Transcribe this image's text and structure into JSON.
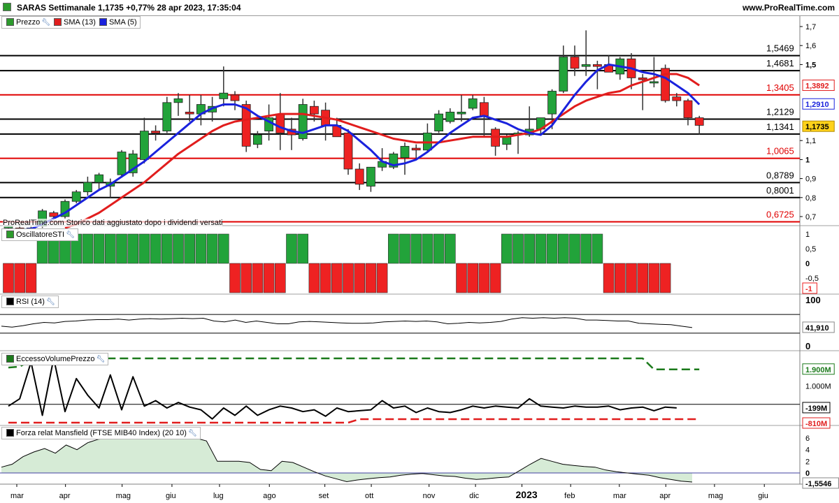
{
  "header": {
    "title": "SARAS Settimanale 1,1735 +0,77% 28 apr 2023, 17:35:04",
    "site": "www.ProRealTime.com"
  },
  "legends": {
    "price": {
      "prezzo": "Prezzo",
      "sma13": "SMA (13)",
      "sma5": "SMA (5)"
    },
    "sti": "OscillatoreSTI",
    "rsi": "RSI (14)",
    "evp": "EccessoVolumePrezzo",
    "mansfield": "Forza relat Mansfield (FTSE MIB40 Index) (20 10)"
  },
  "note": "ProRealTime.com  Storico dati aggiustato dopo i dividendi versati",
  "colors": {
    "up": "#22a33a",
    "down": "#ee2222",
    "sma5": "#1a22dd",
    "sma13": "#e11d1d",
    "level_black": "#000000",
    "level_red": "#e00000",
    "rsi": "#000000",
    "mansfield_fill_pos": "#cfe8cf",
    "mansfield_fill_neg": "#e8c7c7"
  },
  "chart_data": [
    {
      "type": "candlestick",
      "name": "price",
      "ylim": [
        0.64,
        1.74
      ],
      "y_ticks": [
        "0,7",
        "0,8",
        "0,9",
        "1",
        "1,1",
        "1,5",
        "1,6",
        "1,7"
      ],
      "x_ticks": [
        "mar",
        "apr",
        "mag",
        "giu",
        "lug",
        "ago",
        "set",
        "ott",
        "nov",
        "dic",
        "2023",
        "feb",
        "mar",
        "apr",
        "mag",
        "giu"
      ],
      "x_tick_weeks": [
        0,
        4.3,
        9.3,
        13.7,
        17.9,
        22.3,
        27.2,
        31.3,
        36.4,
        40.5,
        44.6,
        48.9,
        53.2,
        57.3,
        61.6,
        66
      ],
      "levels": [
        {
          "value": 1.5469,
          "label": "1,5469",
          "color": "black"
        },
        {
          "value": 1.4681,
          "label": "1,4681",
          "color": "black"
        },
        {
          "value": 1.3405,
          "label": "1,3405",
          "color": "red"
        },
        {
          "value": 1.2129,
          "label": "1,2129",
          "color": "black"
        },
        {
          "value": 1.1341,
          "label": "1,1341",
          "color": "black"
        },
        {
          "value": 1.0065,
          "label": "1,0065",
          "color": "red"
        },
        {
          "value": 0.8789,
          "label": "0,8789",
          "color": "black"
        },
        {
          "value": 0.8001,
          "label": "0,8001",
          "color": "black"
        },
        {
          "value": 0.6725,
          "label": "0,6725",
          "color": "red"
        }
      ],
      "last_price": {
        "value": 1.1735,
        "label": "1,1735"
      },
      "sma13_last": {
        "value": 1.3892,
        "label": "1,3892"
      },
      "sma5_last": {
        "value": 1.291,
        "label": "1,2910"
      },
      "candles": [
        {
          "o": 0.64,
          "h": 0.66,
          "l": 0.6,
          "c": 0.65
        },
        {
          "o": 0.64,
          "h": 0.66,
          "l": 0.61,
          "c": 0.63
        },
        {
          "o": 0.63,
          "h": 0.65,
          "l": 0.6,
          "c": 0.64
        },
        {
          "o": 0.65,
          "h": 0.74,
          "l": 0.64,
          "c": 0.73
        },
        {
          "o": 0.72,
          "h": 0.73,
          "l": 0.68,
          "c": 0.7
        },
        {
          "o": 0.7,
          "h": 0.79,
          "l": 0.69,
          "c": 0.78
        },
        {
          "o": 0.78,
          "h": 0.84,
          "l": 0.77,
          "c": 0.83
        },
        {
          "o": 0.83,
          "h": 0.91,
          "l": 0.81,
          "c": 0.88
        },
        {
          "o": 0.88,
          "h": 0.93,
          "l": 0.84,
          "c": 0.92
        },
        {
          "o": 0.86,
          "h": 0.9,
          "l": 0.8,
          "c": 0.88
        },
        {
          "o": 0.92,
          "h": 1.05,
          "l": 0.91,
          "c": 1.04
        },
        {
          "o": 0.93,
          "h": 1.05,
          "l": 0.91,
          "c": 1.03
        },
        {
          "o": 1.0,
          "h": 1.22,
          "l": 0.98,
          "c": 1.15
        },
        {
          "o": 1.15,
          "h": 1.18,
          "l": 1.1,
          "c": 1.14
        },
        {
          "o": 1.15,
          "h": 1.33,
          "l": 1.14,
          "c": 1.3
        },
        {
          "o": 1.3,
          "h": 1.35,
          "l": 1.23,
          "c": 1.32
        },
        {
          "o": 1.25,
          "h": 1.34,
          "l": 1.2,
          "c": 1.24
        },
        {
          "o": 1.24,
          "h": 1.34,
          "l": 1.18,
          "c": 1.29
        },
        {
          "o": 1.25,
          "h": 1.33,
          "l": 1.2,
          "c": 1.28
        },
        {
          "o": 1.32,
          "h": 1.49,
          "l": 1.28,
          "c": 1.35
        },
        {
          "o": 1.34,
          "h": 1.36,
          "l": 1.26,
          "c": 1.31
        },
        {
          "o": 1.29,
          "h": 1.31,
          "l": 1.04,
          "c": 1.07
        },
        {
          "o": 1.08,
          "h": 1.15,
          "l": 1.06,
          "c": 1.13
        },
        {
          "o": 1.15,
          "h": 1.29,
          "l": 1.1,
          "c": 1.22
        },
        {
          "o": 1.24,
          "h": 1.35,
          "l": 1.05,
          "c": 1.14
        },
        {
          "o": 1.16,
          "h": 1.22,
          "l": 1.05,
          "c": 1.13
        },
        {
          "o": 1.11,
          "h": 1.32,
          "l": 1.1,
          "c": 1.29
        },
        {
          "o": 1.28,
          "h": 1.31,
          "l": 1.2,
          "c": 1.24
        },
        {
          "o": 1.26,
          "h": 1.3,
          "l": 1.1,
          "c": 1.18
        },
        {
          "o": 1.18,
          "h": 1.22,
          "l": 1.12,
          "c": 1.12
        },
        {
          "o": 1.14,
          "h": 1.16,
          "l": 0.92,
          "c": 0.95
        },
        {
          "o": 0.95,
          "h": 0.98,
          "l": 0.84,
          "c": 0.87
        },
        {
          "o": 0.86,
          "h": 0.96,
          "l": 0.83,
          "c": 0.96
        },
        {
          "o": 0.96,
          "h": 1.06,
          "l": 0.94,
          "c": 0.99
        },
        {
          "o": 0.96,
          "h": 1.04,
          "l": 0.95,
          "c": 1.03
        },
        {
          "o": 1.01,
          "h": 1.09,
          "l": 0.92,
          "c": 1.07
        },
        {
          "o": 1.06,
          "h": 1.08,
          "l": 1.0,
          "c": 1.05
        },
        {
          "o": 1.05,
          "h": 1.19,
          "l": 1.04,
          "c": 1.14
        },
        {
          "o": 1.15,
          "h": 1.26,
          "l": 1.14,
          "c": 1.24
        },
        {
          "o": 1.2,
          "h": 1.27,
          "l": 1.19,
          "c": 1.25
        },
        {
          "o": 1.24,
          "h": 1.34,
          "l": 1.2,
          "c": 1.25
        },
        {
          "o": 1.27,
          "h": 1.34,
          "l": 1.26,
          "c": 1.32
        },
        {
          "o": 1.3,
          "h": 1.33,
          "l": 1.12,
          "c": 1.23
        },
        {
          "o": 1.16,
          "h": 1.17,
          "l": 1.02,
          "c": 1.07
        },
        {
          "o": 1.08,
          "h": 1.13,
          "l": 1.05,
          "c": 1.12
        },
        {
          "o": 1.13,
          "h": 1.15,
          "l": 1.03,
          "c": 1.14
        },
        {
          "o": 1.13,
          "h": 1.28,
          "l": 1.12,
          "c": 1.16
        },
        {
          "o": 1.16,
          "h": 1.22,
          "l": 1.13,
          "c": 1.22
        },
        {
          "o": 1.24,
          "h": 1.37,
          "l": 1.16,
          "c": 1.36
        },
        {
          "o": 1.36,
          "h": 1.6,
          "l": 1.35,
          "c": 1.54
        },
        {
          "o": 1.54,
          "h": 1.6,
          "l": 1.44,
          "c": 1.48
        },
        {
          "o": 1.49,
          "h": 1.68,
          "l": 1.44,
          "c": 1.5
        },
        {
          "o": 1.5,
          "h": 1.52,
          "l": 1.37,
          "c": 1.49
        },
        {
          "o": 1.5,
          "h": 1.55,
          "l": 1.47,
          "c": 1.46
        },
        {
          "o": 1.45,
          "h": 1.54,
          "l": 1.42,
          "c": 1.53
        },
        {
          "o": 1.53,
          "h": 1.56,
          "l": 1.37,
          "c": 1.43
        },
        {
          "o": 1.43,
          "h": 1.45,
          "l": 1.26,
          "c": 1.42
        },
        {
          "o": 1.41,
          "h": 1.54,
          "l": 1.38,
          "c": 1.41
        },
        {
          "o": 1.48,
          "h": 1.5,
          "l": 1.3,
          "c": 1.31
        },
        {
          "o": 1.33,
          "h": 1.35,
          "l": 1.28,
          "c": 1.31
        },
        {
          "o": 1.31,
          "h": 1.32,
          "l": 1.18,
          "c": 1.22
        },
        {
          "o": 1.22,
          "h": 1.23,
          "l": 1.13,
          "c": 1.18
        }
      ],
      "sma5": [
        0.62,
        0.63,
        0.635,
        0.66,
        0.69,
        0.72,
        0.76,
        0.8,
        0.84,
        0.87,
        0.91,
        0.95,
        0.99,
        1.04,
        1.09,
        1.14,
        1.19,
        1.24,
        1.27,
        1.29,
        1.29,
        1.27,
        1.23,
        1.2,
        1.17,
        1.15,
        1.14,
        1.16,
        1.18,
        1.18,
        1.15,
        1.1,
        1.05,
        0.99,
        0.97,
        0.98,
        1.0,
        1.04,
        1.09,
        1.14,
        1.18,
        1.22,
        1.23,
        1.21,
        1.19,
        1.16,
        1.14,
        1.13,
        1.18,
        1.26,
        1.34,
        1.41,
        1.47,
        1.5,
        1.49,
        1.48,
        1.46,
        1.45,
        1.43,
        1.39,
        1.35,
        1.29
      ],
      "sma13": [
        null,
        null,
        null,
        null,
        null,
        0.64,
        0.66,
        0.69,
        0.72,
        0.76,
        0.8,
        0.84,
        0.88,
        0.93,
        0.98,
        1.03,
        1.07,
        1.11,
        1.15,
        1.18,
        1.2,
        1.21,
        1.22,
        1.23,
        1.24,
        1.24,
        1.24,
        1.23,
        1.22,
        1.21,
        1.19,
        1.17,
        1.15,
        1.13,
        1.11,
        1.1,
        1.09,
        1.09,
        1.09,
        1.1,
        1.11,
        1.12,
        1.12,
        1.12,
        1.12,
        1.13,
        1.14,
        1.16,
        1.2,
        1.24,
        1.28,
        1.31,
        1.33,
        1.35,
        1.36,
        1.39,
        1.41,
        1.43,
        1.45,
        1.45,
        1.43,
        1.39
      ]
    },
    {
      "type": "bar",
      "name": "OscillatoreSTI",
      "ylim": [
        -1,
        1
      ],
      "y_ticks": [
        "1",
        "0,5",
        "0",
        "-0,5"
      ],
      "last": {
        "value": -1,
        "label": "-1"
      },
      "values": [
        -1,
        -1,
        -1,
        1,
        1,
        1,
        1,
        1,
        1,
        1,
        1,
        1,
        1,
        1,
        1,
        1,
        1,
        1,
        1,
        1,
        -1,
        -1,
        -1,
        -1,
        -1,
        1,
        1,
        -1,
        -1,
        -1,
        -1,
        -1,
        -1,
        -1,
        1,
        1,
        1,
        1,
        1,
        1,
        -1,
        -1,
        -1,
        -1,
        1,
        1,
        1,
        1,
        1,
        1,
        1,
        1,
        1,
        -1,
        -1,
        -1,
        -1,
        -1,
        -1
      ]
    },
    {
      "type": "line",
      "name": "RSI (14)",
      "ylim": [
        0,
        100
      ],
      "y_ticks": [
        "100",
        "0"
      ],
      "last": {
        "value": 41.91,
        "label": "41,910"
      },
      "values": [
        45,
        43,
        46,
        50,
        53,
        52,
        55,
        56,
        58,
        59,
        59,
        60,
        58,
        60,
        61,
        60,
        61,
        62,
        61,
        62,
        56,
        54,
        58,
        53,
        56,
        53,
        50,
        50,
        54,
        55,
        54,
        53,
        52,
        51,
        51,
        52,
        54,
        55,
        56,
        55,
        56,
        54,
        50,
        51,
        53,
        52,
        53,
        55,
        60,
        63,
        62,
        63,
        62,
        63,
        62,
        58,
        58,
        57,
        56,
        56,
        51,
        50,
        49,
        48,
        45,
        41.91
      ]
    },
    {
      "type": "line",
      "name": "EccessoVolumePrezzo",
      "ylim": [
        -1000000,
        3200000
      ],
      "y_ticks": [
        "1.000M"
      ],
      "series": [
        {
          "name": "upper",
          "last_label": "1.900M",
          "values": [
            2000000,
            2050000,
            2400000,
            2400000,
            2400000,
            2500000,
            2500000,
            2500000,
            2500000,
            2500000,
            2500000,
            2500000,
            2500000,
            2500000,
            2500000,
            2500000,
            2500000,
            2500000,
            2500000,
            2500000,
            2500000,
            2500000,
            2500000,
            2500000,
            2500000,
            2500000,
            2500000,
            2500000,
            2500000,
            2500000,
            2500000,
            2500000,
            2500000,
            2500000,
            2500000,
            2500000,
            2500000,
            2500000,
            2500000,
            2500000,
            2500000,
            2500000,
            2500000,
            2500000,
            2500000,
            2500000,
            2500000,
            2500000,
            2500000,
            2500000,
            2500000,
            2500000,
            2500000,
            2500000,
            2500000,
            2500000,
            2500000,
            1900000,
            1900000,
            1900000,
            1900000,
            1900000
          ]
        },
        {
          "name": "value",
          "last_label": "-199M",
          "values": [
            -100000,
            300000,
            2300000,
            -600000,
            2500000,
            -400000,
            1400000,
            500000,
            -200000,
            1600000,
            -300000,
            1500000,
            -100000,
            200000,
            -200000,
            100000,
            -150000,
            -300000,
            -800000,
            -200000,
            -600000,
            -100000,
            -600000,
            -300000,
            -100000,
            -200000,
            -400000,
            -300000,
            -650000,
            -200000,
            -400000,
            -350000,
            -300000,
            200000,
            -200000,
            -100000,
            -450000,
            -200000,
            -400000,
            -450000,
            -300000,
            -100000,
            -200000,
            -100000,
            -150000,
            -200000,
            300000,
            -100000,
            -150000,
            -200000,
            -100000,
            -150000,
            -150000,
            -100000,
            -300000,
            -200000,
            -150000,
            -350000,
            -150000,
            -199000
          ]
        },
        {
          "name": "lower",
          "last_label": "-810M",
          "values": [
            -1000000,
            -1000000,
            -1000000,
            -1000000,
            -1000000,
            -1000000,
            -1000000,
            -1000000,
            -1000000,
            -1000000,
            -1000000,
            -1000000,
            -1000000,
            -1000000,
            -1000000,
            -1000000,
            -1000000,
            -1000000,
            -1000000,
            -1000000,
            -1000000,
            -1000000,
            -1000000,
            -1000000,
            -1000000,
            -1000000,
            -1000000,
            -1000000,
            -1000000,
            -1000000,
            -1000000,
            -810000,
            -810000,
            -810000,
            -810000,
            -810000,
            -810000,
            -810000,
            -810000,
            -810000,
            -810000,
            -810000,
            -810000,
            -810000,
            -810000,
            -810000,
            -810000,
            -810000,
            -810000,
            -810000,
            -810000,
            -810000,
            -810000,
            -810000,
            -810000,
            -810000,
            -810000,
            -810000,
            -810000,
            -810000,
            -810000,
            -810000
          ]
        }
      ]
    },
    {
      "type": "area",
      "name": "Forza relat Mansfield (FTSE MIB40 Index) (20 10)",
      "ylim": [
        -3,
        7
      ],
      "y_ticks": [
        "6",
        "4",
        "2",
        "0"
      ],
      "last": {
        "value": -1.5546,
        "label": "-1,5546"
      },
      "values": [
        1,
        1.5,
        2.8,
        3.6,
        4.2,
        3.4,
        4.8,
        4.0,
        5.2,
        5.8,
        6.0,
        6.4,
        6.6,
        6.3,
        6.5,
        6.2,
        6.7,
        6.6,
        6.0,
        5.5,
        2.0,
        2.0,
        2.0,
        1.8,
        0.6,
        0.4,
        2.0,
        1.8,
        1.0,
        0.2,
        -0.5,
        -1.0,
        -1.5,
        -1.2,
        -1.0,
        -0.8,
        -0.7,
        -0.4,
        -0.2,
        -0.1,
        -0.3,
        -0.5,
        -0.6,
        -0.9,
        -1.1,
        -1.0,
        -0.8,
        -0.7,
        0.4,
        1.5,
        2.5,
        2.0,
        1.5,
        1.3,
        1.1,
        1.0,
        0.5,
        0.2,
        0.0,
        -0.2,
        -0.4,
        -0.8,
        -1.1,
        -1.4,
        -1.5546
      ]
    }
  ]
}
